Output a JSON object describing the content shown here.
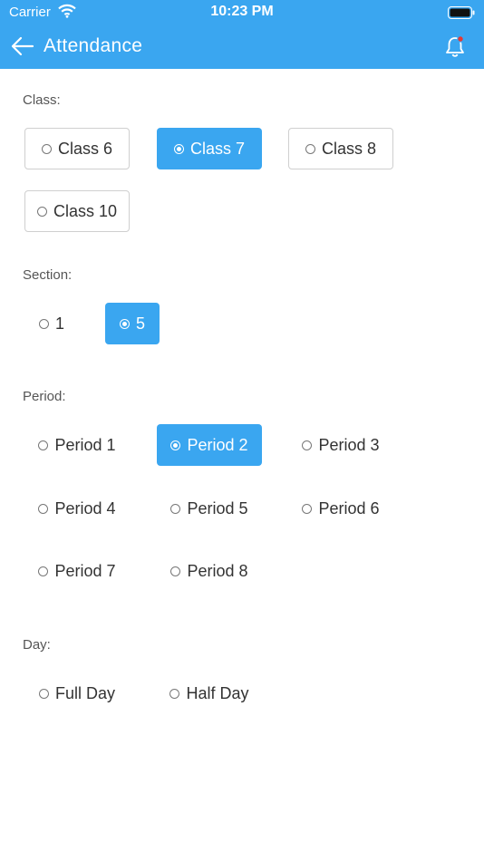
{
  "status_bar": {
    "carrier": "Carrier",
    "time": "10:23 PM"
  },
  "app_bar": {
    "title": "Attendance",
    "back_icon": "arrow-left-icon",
    "bell_icon": "bell-icon",
    "accent": "#3aa6f0",
    "notification_dot": "#e53935"
  },
  "class_group": {
    "label": "Class:",
    "options": [
      "Class 6",
      "Class 7",
      "Class 8",
      "Class 10"
    ],
    "selected": "Class 7"
  },
  "section_group": {
    "label": "Section:",
    "options": [
      "1",
      "5"
    ],
    "selected": "5"
  },
  "period_group": {
    "label": "Period:",
    "options": [
      "Period 1",
      "Period 2",
      "Period 3",
      "Period 4",
      "Period 5",
      "Period 6",
      "Period 7",
      "Period 8"
    ],
    "selected": "Period 2"
  },
  "day_group": {
    "label": "Day:",
    "options": [
      "Full Day",
      "Half Day"
    ],
    "selected": null
  }
}
